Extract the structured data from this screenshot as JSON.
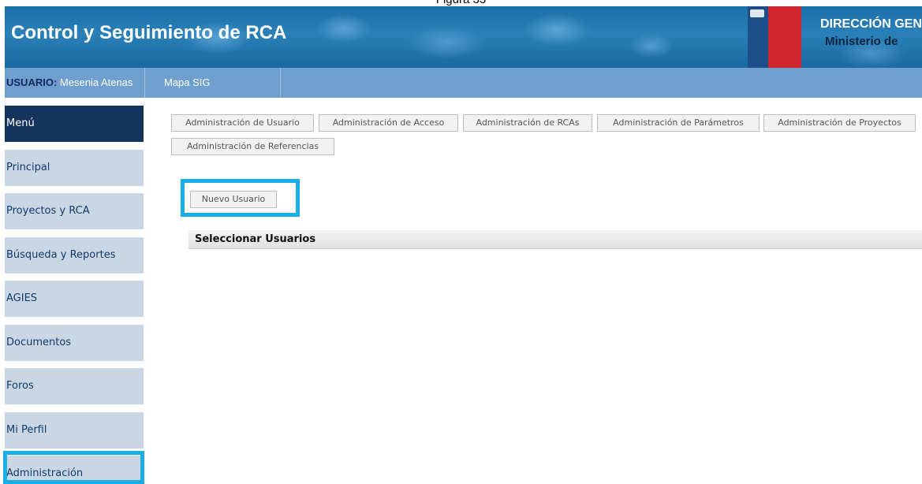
{
  "caption": "Figura 33",
  "header": {
    "app_title": "Control y Seguimiento de RCA",
    "dept_line1": "DIRECCIÓN GEN",
    "dept_line2": "Ministerio de"
  },
  "topbar": {
    "user_label": "USUARIO:",
    "user_name": "Mesenia Atenas",
    "mapa_sig": "Mapa SIG"
  },
  "sidebar": {
    "menu_label": "Menú",
    "items": [
      {
        "label": "Principal"
      },
      {
        "label": "Proyectos y RCA"
      },
      {
        "label": "Búsqueda y Reportes"
      },
      {
        "label": "AGIES"
      },
      {
        "label": "Documentos"
      },
      {
        "label": "Foros"
      },
      {
        "label": "Mi Perfil"
      },
      {
        "label": "Administración"
      }
    ]
  },
  "admin_tabs": [
    {
      "label": "Administración de Usuario"
    },
    {
      "label": "Administración de Acceso"
    },
    {
      "label": "Administración de RCAs"
    },
    {
      "label": "Administración de Parámetros"
    },
    {
      "label": "Administración de Proyectos"
    },
    {
      "label": "Administración de Referencias"
    }
  ],
  "main": {
    "new_user_button": "Nuevo Usuario",
    "section_title": "Seleccionar Usuarios"
  },
  "colors": {
    "banner": "#1d6fa8",
    "topbar": "#6e9fcf",
    "menu_active": "#14345e",
    "sidebar_item": "#c9d6e3",
    "highlight": "#19aee6"
  }
}
